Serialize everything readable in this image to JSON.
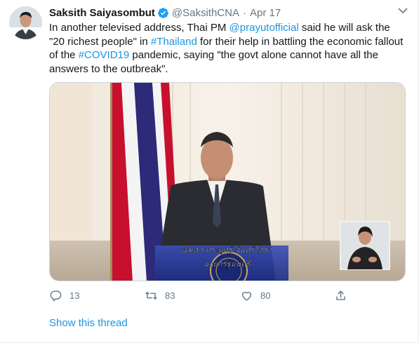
{
  "author": {
    "name": "Saksith Saiyasombut",
    "handle": "@SaksithCNA",
    "separator": "·",
    "date": "Apr 17",
    "verified": true
  },
  "tweet": {
    "t1": "In another televised address, Thai PM ",
    "mention": "@prayutofficial",
    "t2": " said he will ask the \"20 richest people\" in ",
    "hashtag1": "#Thailand",
    "t3": " for their help in battling the economic fallout of the ",
    "hashtag2": "#COVID19",
    "t4": " pandemic, saying \"the govt alone cannot have all the answers to the outbreak\"."
  },
  "media": {
    "caption_line1": "พลเอก ประยุทธ์ จันทร์โอชา",
    "caption_line2": "นายกรัฐมนตรี"
  },
  "actions": {
    "replies": "13",
    "retweets": "83",
    "likes": "80"
  },
  "show_thread": "Show this thread",
  "colors": {
    "link": "#1b95e0",
    "secondary_text": "#657786",
    "verified": "#1da1f2"
  }
}
